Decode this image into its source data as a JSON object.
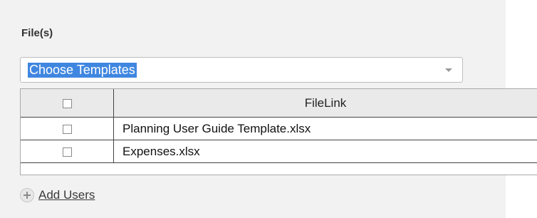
{
  "section": {
    "label": "File(s)"
  },
  "template_select": {
    "selected_value": "Choose Templates",
    "arrow_icon": "chevron-down-icon"
  },
  "grid": {
    "headers": {
      "check": "",
      "filelink": "FileLink"
    },
    "rows": [
      {
        "checked": false,
        "filelink": "Planning User Guide Template.xlsx"
      },
      {
        "checked": false,
        "filelink": "Expenses.xlsx"
      }
    ]
  },
  "add_users": {
    "label": "Add Users",
    "icon": "plus-circle-icon"
  },
  "colors": {
    "selection_highlight": "#3f86e0",
    "panel_bg": "#f2f2f2"
  }
}
